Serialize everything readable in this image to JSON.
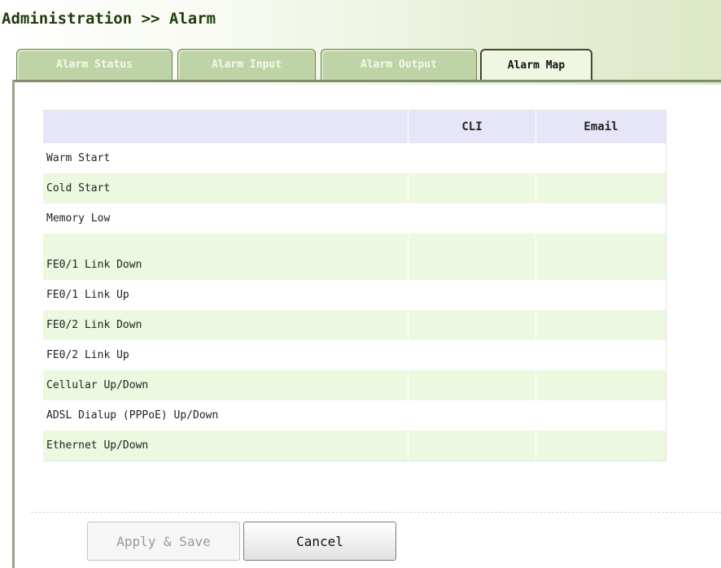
{
  "header": {
    "title": "Administration >> Alarm"
  },
  "tabs": [
    {
      "label": "Alarm Status",
      "active": false
    },
    {
      "label": "Alarm Input",
      "active": false
    },
    {
      "label": "Alarm Output",
      "active": false
    },
    {
      "label": "Alarm Map",
      "active": true
    }
  ],
  "table": {
    "columns": [
      "",
      "CLI",
      "Email"
    ],
    "rows": [
      "Warm Start",
      "Cold Start",
      "Memory Low",
      "FE0/1 Link Down",
      "FE0/1 Link Up",
      "FE0/2 Link Down",
      "FE0/2 Link Up",
      "Cellular Up/Down",
      "ADSL Dialup (PPPoE) Up/Down",
      "Ethernet Up/Down"
    ]
  },
  "buttons": {
    "apply": "Apply & Save",
    "cancel": "Cancel"
  },
  "colors": {
    "title": "#1f3d0c",
    "tab_inactive": "#bfd4a6",
    "tab_active": "#eff7e3",
    "row_alt": "#ecf8df",
    "table_header": "#e6e6f8"
  }
}
